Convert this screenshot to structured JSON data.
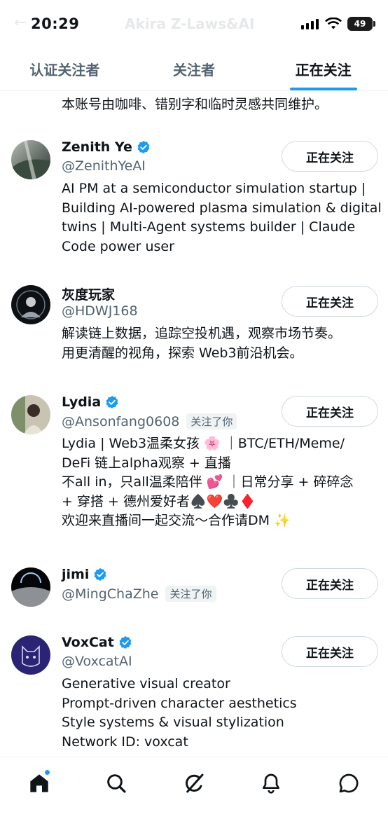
{
  "status_bar": {
    "time": "20:29",
    "battery": "49",
    "ghost_title": "Akira Z-Laws&AI"
  },
  "tabs": [
    {
      "label": "认证关注者",
      "active": false
    },
    {
      "label": "关注者",
      "active": false
    },
    {
      "label": "正在关注",
      "active": true
    }
  ],
  "previous_bio_tail": "本账号由咖啡、错别字和临时灵感共同维护。",
  "users": [
    {
      "name": "Zenith Ye",
      "verified": true,
      "handle": "@ZenithYeAI",
      "follows_you": null,
      "button": "正在关注",
      "bio": [
        "AI PM at a semiconductor simulation startup |",
        "Building AI-powered plasma simulation & digital",
        "twins | Multi-Agent systems builder | Claude",
        "Code power user"
      ]
    },
    {
      "name": "灰度玩家",
      "verified": false,
      "handle": "@HDWJ168",
      "follows_you": null,
      "button": "正在关注",
      "bio": [
        "解读链上数据，追踪空投机遇，观察市场节奏。",
        "用更清醒的视角，探索 Web3前沿机会。"
      ]
    },
    {
      "name": "Lydia",
      "verified": true,
      "handle": "@Ansonfang0608",
      "follows_you": "关注了你",
      "button": "正在关注",
      "bio": [
        "Lydia | Web3温柔女孩 🌸 ｜BTC/ETH/Meme/",
        "DeFi 链上alpha观察 + 直播",
        "不all in，只all温柔陪伴 💕 ｜日常分享 + 碎碎念",
        "+ 穿搭 + 德州爱好者♠️❤️♣️♦️",
        "欢迎来直播间一起交流～合作请DM ✨"
      ]
    },
    {
      "name": "jimi",
      "verified": true,
      "handle": "@MingChaZhe",
      "follows_you": "关注了你",
      "button": "正在关注",
      "bio": []
    },
    {
      "name": "VoxCat",
      "verified": true,
      "handle": "@VoxcatAI",
      "follows_you": null,
      "button": "正在关注",
      "bio": [
        "Generative visual creator",
        "Prompt-driven character aesthetics",
        "Style systems & visual stylization",
        "Network ID: voxcat"
      ]
    }
  ],
  "bottom_nav": [
    "home-icon",
    "search-icon",
    "grok-icon",
    "notifications-icon",
    "messages-icon"
  ],
  "colors": {
    "accent": "#1d9bf0",
    "text": "#0f1419",
    "secondary": "#536471",
    "border": "#cfd9de"
  }
}
